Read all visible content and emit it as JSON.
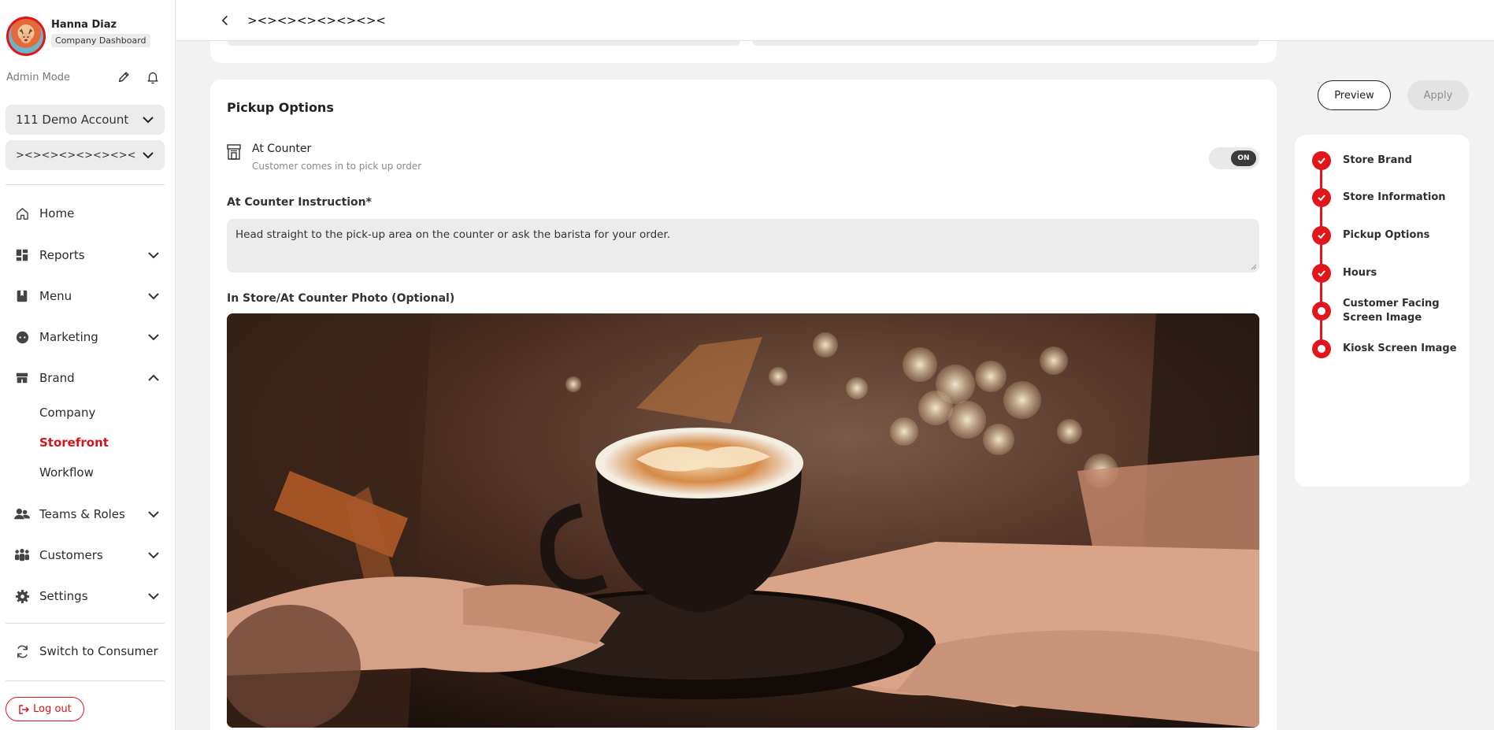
{
  "profile": {
    "name": "Hanna Diaz",
    "badge": "Company Dashboard"
  },
  "admin": {
    "label": "Admin Mode"
  },
  "selects": {
    "account": "111 Demo Account",
    "store": "><><><><><><><"
  },
  "nav": {
    "home": "Home",
    "reports": "Reports",
    "menu": "Menu",
    "marketing": "Marketing",
    "brand": "Brand",
    "brand_sub": [
      "Company",
      "Storefront",
      "Workflow"
    ],
    "teams": "Teams & Roles",
    "customers": "Customers",
    "settings": "Settings",
    "switch": "Switch to Consumer"
  },
  "logout": "Log out",
  "header": {
    "title": "><><><><><><><"
  },
  "pickup": {
    "section_title": "Pickup Options",
    "option_title": "At Counter",
    "option_desc": "Customer comes in to pick up order",
    "toggle_state": "ON",
    "instruction_label": "At Counter Instruction*",
    "instruction_value": "Head straight to the pick-up area on the counter or ask the barista for your order.",
    "photo_label": "In Store/At Counter Photo (Optional)"
  },
  "actions": {
    "preview": "Preview",
    "apply": "Apply"
  },
  "steps": [
    {
      "label": "Store Brand",
      "status": "done"
    },
    {
      "label": "Store Information",
      "status": "done"
    },
    {
      "label": "Pickup Options",
      "status": "done"
    },
    {
      "label": "Hours",
      "status": "done"
    },
    {
      "label": "Customer Facing Screen Image",
      "status": "pending"
    },
    {
      "label": "Kiosk Screen Image",
      "status": "pending"
    }
  ],
  "colors": {
    "accent": "#e0161b",
    "background": "#f2f2f2",
    "card": "#ffffff"
  }
}
